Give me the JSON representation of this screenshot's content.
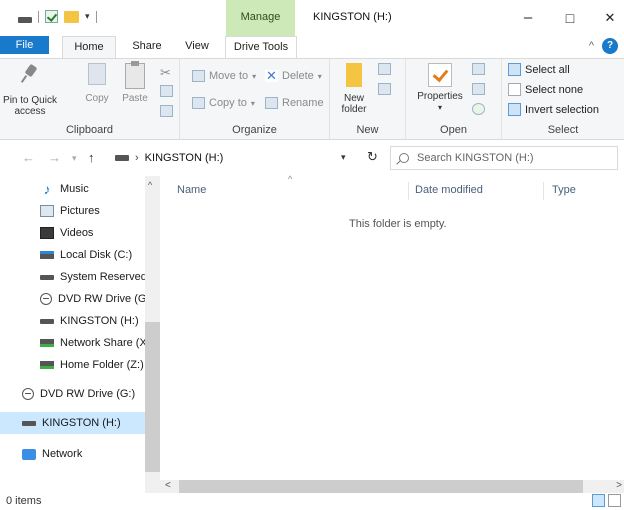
{
  "window": {
    "title": "KINGSTON (H:)",
    "contextual_tab": "Manage",
    "controls": {
      "minimize": "–",
      "maximize": "□",
      "close": "✕"
    }
  },
  "quick_access_toolbar": {
    "dropdown": "▾"
  },
  "tabs": {
    "file": "File",
    "home": "Home",
    "share": "Share",
    "view": "View",
    "drive_tools": "Drive Tools",
    "collapse": "^",
    "help": "?"
  },
  "ribbon": {
    "clipboard": {
      "label": "Clipboard",
      "pin_line1": "Pin to Quick",
      "pin_line2": "access",
      "copy": "Copy",
      "paste": "Paste"
    },
    "organize": {
      "label": "Organize",
      "move_to": "Move to",
      "copy_to": "Copy to",
      "delete": "Delete",
      "rename": "Rename",
      "dropdown": "▾"
    },
    "new": {
      "label": "New",
      "new_folder_line1": "New",
      "new_folder_line2": "folder"
    },
    "open": {
      "label": "Open",
      "properties": "Properties",
      "properties_dd": "▾"
    },
    "select": {
      "label": "Select",
      "select_all": "Select all",
      "select_none": "Select none",
      "invert_selection": "Invert selection"
    }
  },
  "address": {
    "back": "←",
    "forward": "→",
    "recent": "▾",
    "up": "↑",
    "separator": "›",
    "path": "KINGSTON (H:)",
    "dropdown": "▾",
    "refresh": "↻",
    "search_placeholder": "Search KINGSTON (H:)"
  },
  "nav_pane": {
    "items": [
      {
        "label": "Music",
        "icon": "music-icon"
      },
      {
        "label": "Pictures",
        "icon": "pictures-icon"
      },
      {
        "label": "Videos",
        "icon": "videos-icon"
      },
      {
        "label": "Local Disk (C:)",
        "icon": "local-disk-icon"
      },
      {
        "label": "System Reserved",
        "icon": "drive-icon"
      },
      {
        "label": "DVD RW Drive (G:",
        "icon": "dvd-drive-icon"
      },
      {
        "label": "KINGSTON (H:)",
        "icon": "usb-drive-icon"
      },
      {
        "label": "Network Share (X",
        "icon": "network-drive-icon"
      },
      {
        "label": "Home Folder (Z:)",
        "icon": "network-drive-icon"
      },
      {
        "label": "DVD RW Drive (G:)",
        "icon": "dvd-drive-icon"
      },
      {
        "label": "KINGSTON (H:)",
        "icon": "usb-drive-icon"
      },
      {
        "label": "Network",
        "icon": "network-icon"
      }
    ]
  },
  "content": {
    "columns": {
      "name": "Name",
      "date_modified": "Date modified",
      "type": "Type"
    },
    "sort_indicator": "^",
    "empty_message": "This folder is empty."
  },
  "scroll": {
    "up": "^",
    "down": "v",
    "left": "<",
    "right": ">"
  },
  "status": {
    "item_count": "0 items"
  }
}
